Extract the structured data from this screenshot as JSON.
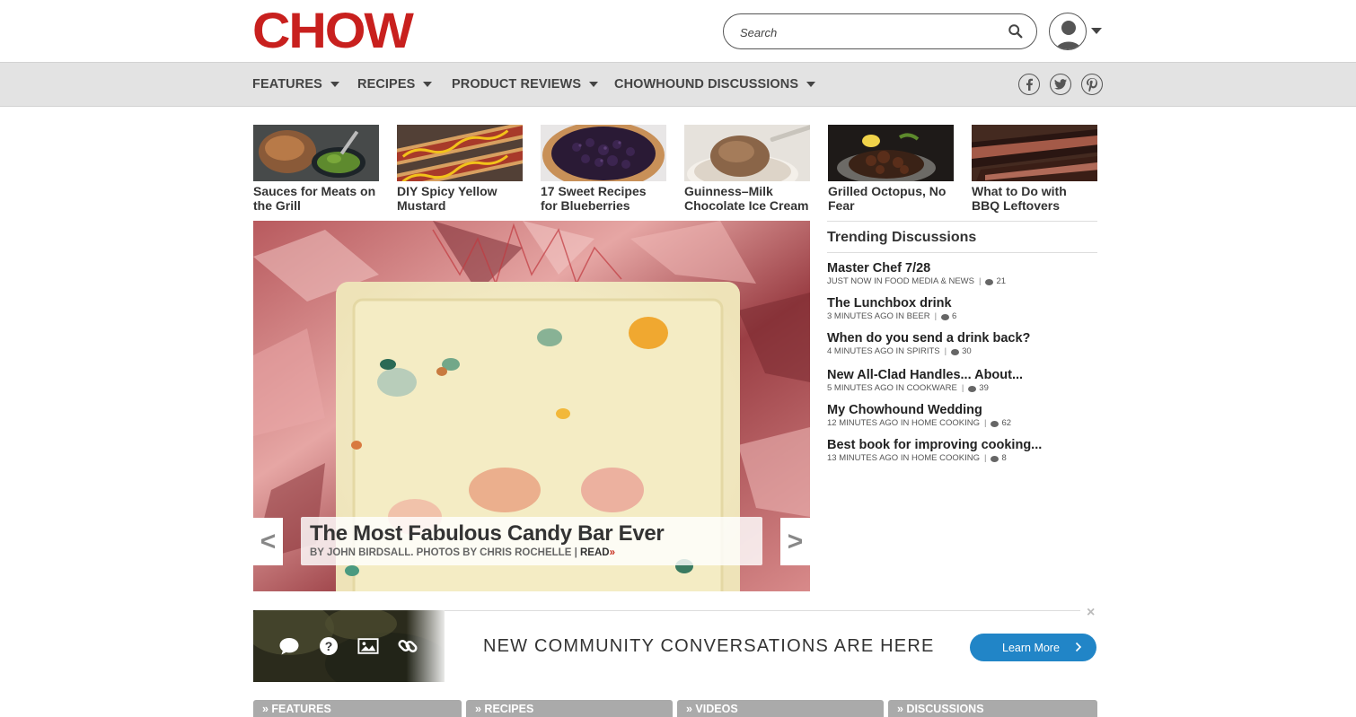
{
  "header": {
    "logo": "CHOW",
    "logo_color": "#c8201e",
    "search_placeholder": "Search"
  },
  "nav": {
    "items": [
      {
        "label": "FEATURES"
      },
      {
        "label": "RECIPES"
      },
      {
        "label": "PRODUCT REVIEWS"
      },
      {
        "label": "CHOWHOUND DISCUSSIONS"
      }
    ],
    "social": [
      "facebook-icon",
      "twitter-icon",
      "pinterest-icon"
    ]
  },
  "thumbnails": [
    {
      "caption": "Sauces for Meats on the Grill",
      "image": "grilled-meat-with-green-sauce"
    },
    {
      "caption": "DIY Spicy Yellow Mustard",
      "image": "hot-dogs-with-mustard"
    },
    {
      "caption": "17 Sweet Recipes for Blueberries",
      "image": "blueberry-galette"
    },
    {
      "caption": "Guinness–Milk Chocolate Ice Cream",
      "image": "chocolate-ice-cream-scoop"
    },
    {
      "caption": "Grilled Octopus, No Fear",
      "image": "grilled-octopus-plate"
    },
    {
      "caption": "What to Do with BBQ Leftovers",
      "image": "smoked-brisket"
    }
  ],
  "hero": {
    "title": "The Most Fabulous Candy Bar Ever",
    "byline": "BY JOHN BIRDSALL. PHOTOS BY CHRIS ROCHELLE",
    "sep": "|",
    "read": "READ",
    "read_arrow": "»",
    "prev": "<",
    "next": ">"
  },
  "trending": {
    "title": "Trending Discussions",
    "items": [
      {
        "title": "Master Chef 7/28",
        "meta": "JUST NOW IN FOOD MEDIA & NEWS",
        "count": "21"
      },
      {
        "title": "The Lunchbox drink",
        "meta": "3 MINUTES AGO IN BEER",
        "count": "6"
      },
      {
        "title": "When do you send a drink back?",
        "meta": "4 MINUTES AGO IN SPIRITS",
        "count": "30"
      },
      {
        "title": "New All-Clad Handles... About...",
        "meta": "5 MINUTES AGO IN COOKWARE",
        "count": "39"
      },
      {
        "title": "My Chowhound Wedding",
        "meta": "12 MINUTES AGO IN HOME COOKING",
        "count": "62"
      },
      {
        "title": "Best book for improving cooking...",
        "meta": "13 MINUTES AGO IN HOME COOKING",
        "count": "8"
      }
    ]
  },
  "promo": {
    "text": "NEW COMMUNITY CONVERSATIONS ARE HERE",
    "button": "Learn More",
    "close": "×",
    "button_color": "#2185c7"
  },
  "bottom_tabs": [
    {
      "label": "» FEATURES"
    },
    {
      "label": "» RECIPES"
    },
    {
      "label": "» VIDEOS"
    },
    {
      "label": "» DISCUSSIONS"
    }
  ]
}
